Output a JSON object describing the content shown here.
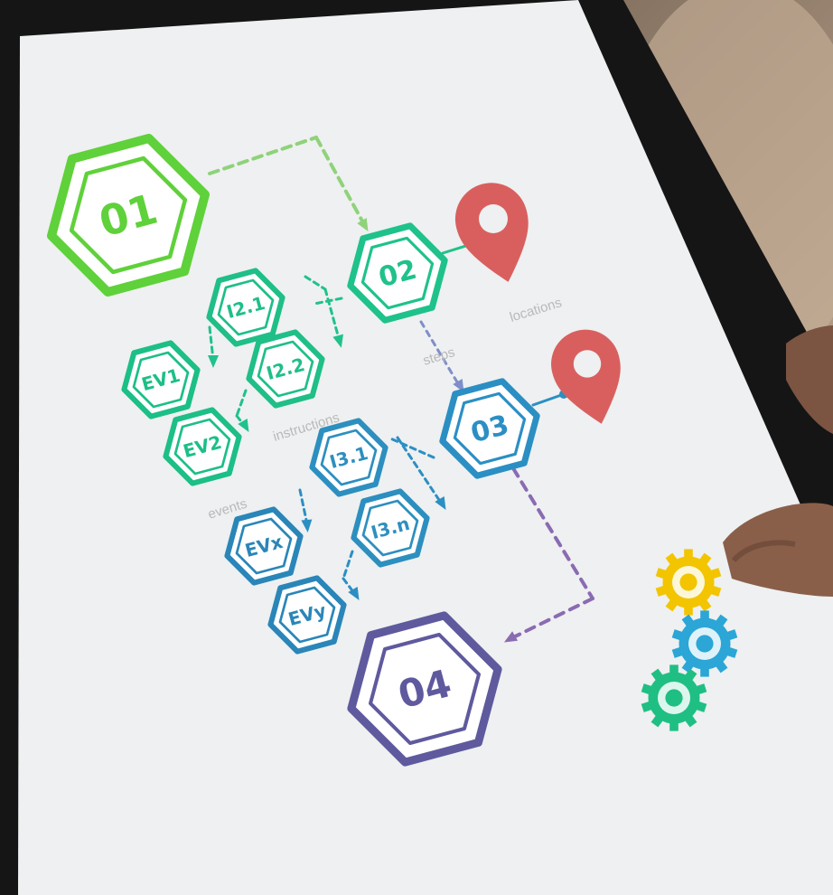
{
  "diagram": {
    "steps": [
      {
        "label": "01",
        "color": "#5fd13a"
      },
      {
        "label": "02",
        "color": "#1fc28a"
      },
      {
        "label": "03",
        "color": "#2b8fc4"
      },
      {
        "label": "04",
        "color": "#5f5a9e"
      }
    ],
    "instructions": [
      {
        "label": "I2.1",
        "color": "#1fbf87"
      },
      {
        "label": "I2.2",
        "color": "#1fbf87"
      },
      {
        "label": "I3.1",
        "color": "#2d8fbf"
      },
      {
        "label": "I3.n",
        "color": "#2d8fbf"
      }
    ],
    "events": [
      {
        "label": "EV1",
        "color": "#1cbf86"
      },
      {
        "label": "EV2",
        "color": "#1cbf86"
      },
      {
        "label": "EVx",
        "color": "#2a86b8"
      },
      {
        "label": "EVy",
        "color": "#2a86b8"
      }
    ],
    "captions": {
      "locations": "locations",
      "steps": "steps",
      "instructions": "instructions",
      "events": "events"
    },
    "pin_color": "#d95f5f",
    "gear_colors": [
      "#f2c500",
      "#2ba6d6",
      "#1fbf84"
    ]
  }
}
